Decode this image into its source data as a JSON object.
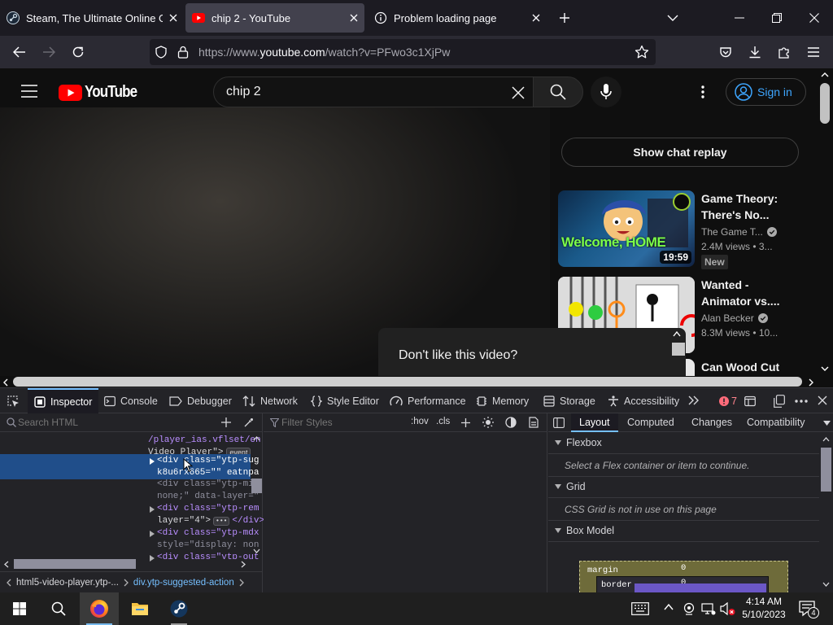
{
  "tabs": [
    {
      "title": "Steam, The Ultimate Online Game Platform",
      "icon": "steam-icon"
    },
    {
      "title": "chip 2 - YouTube",
      "icon": "youtube-icon"
    },
    {
      "title": "Problem loading page",
      "icon": "info-icon"
    }
  ],
  "url": {
    "domain_prefix": "https://www.",
    "domain": "youtube.com",
    "path": "/watch?v=PFwo3c1XjPw"
  },
  "youtube": {
    "logo_text": "YouTube",
    "search_query": "chip 2",
    "sign_in": "Sign in",
    "show_chat_replay": "Show chat replay",
    "dislike_prompt": "Don't like this video?",
    "videos": [
      {
        "title": "Game Theory: There's No...",
        "channel": "The Game T...",
        "meta": "2.4M views  • 3...",
        "duration": "19:59",
        "badge": "New",
        "thumb_text": "Welcome, HOME"
      },
      {
        "title": "Wanted - Animator vs....",
        "channel": "Alan Becker",
        "meta": "8.3M views  • 10...",
        "duration": "",
        "badge": ""
      },
      {
        "title": "Can Wood Cut",
        "channel": "",
        "meta": "",
        "duration": "",
        "badge": ""
      }
    ]
  },
  "devtools": {
    "tabs": [
      "Inspector",
      "Console",
      "Debugger",
      "Network",
      "Style Editor",
      "Performance",
      "Memory",
      "Storage",
      "Accessibility"
    ],
    "error_count": "7",
    "search_placeholder": "Search HTML",
    "filter_placeholder": "Filter Styles",
    "hov": ":hov",
    "cls": ".cls",
    "html_lines": [
      "/player_ias.vflset/en",
      "Video Player\">",
      "<div class=\"ytp-sug",
      "k8u6rx665=\"\" eatnpa",
      "<div class=\"ytp-min",
      "none;\" data-layer=\"",
      "<div class=\"ytp-rem",
      "layer=\"4\">",
      "</div>",
      "<div class=\"ytp-mdx",
      "style=\"display: non",
      "<div class=\"ytp-out"
    ],
    "event_badge": "event",
    "ellipsis_badge": "•••",
    "breadcrumbs": [
      "html5-video-player.ytp-...",
      "div.ytp-suggested-action"
    ],
    "layout_tabs": [
      "Layout",
      "Computed",
      "Changes",
      "Compatibility"
    ],
    "sections": [
      {
        "title": "Flexbox",
        "note": "Select a Flex container or item to continue."
      },
      {
        "title": "Grid",
        "note": "CSS Grid is not in use on this page"
      },
      {
        "title": "Box Model",
        "note": ""
      }
    ],
    "box_model": {
      "margin_label": "margin",
      "margin_value": "0",
      "border_label": "border",
      "border_value": "0"
    }
  },
  "taskbar": {
    "time": "4:14 AM",
    "date": "5/10/2023",
    "notification_count": "4"
  },
  "colors": {
    "accent": "#75bfff",
    "youtube_red": "#ff0000",
    "link_blue": "#3ea6ff"
  }
}
